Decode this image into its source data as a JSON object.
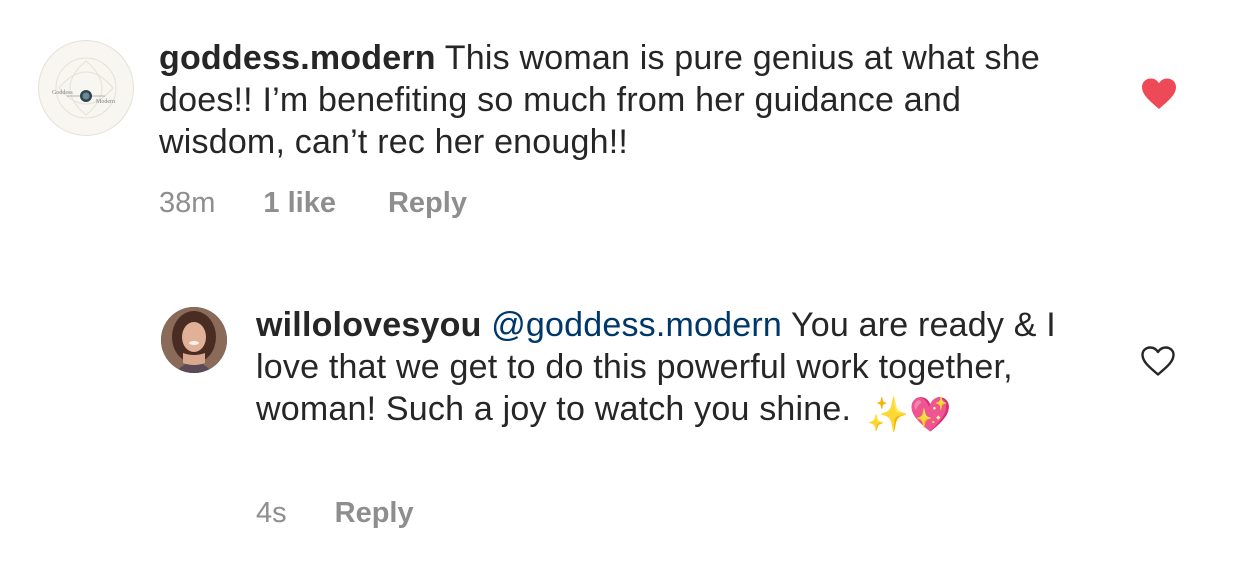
{
  "comments": [
    {
      "avatar_icon": "goddess-modern-logo",
      "avatar_logo_text_left": "Goddess",
      "avatar_logo_text_right": "Modern",
      "username": "goddess.modern",
      "text": "This woman is pure genius at what she does!! I’m benefiting so much from her guidance and wisdom, can’t rec her enough!!",
      "time": "38m",
      "likes": "1 like",
      "reply_label": "Reply",
      "liked": true,
      "heart_color": "#ed4956"
    },
    {
      "avatar_icon": "user-photo-avatar",
      "username": "willolovesyou",
      "mention": "@goddess.modern",
      "text": "You are ready & I love that we get to do this powerful work together, woman! Such a joy to watch you shine.",
      "emoji": "✨💖",
      "time": "4s",
      "reply_label": "Reply",
      "liked": false,
      "heart_color": "#262626"
    }
  ],
  "colors": {
    "text": "#262626",
    "meta": "#8e8e8e",
    "mention": "#00376b",
    "like_red": "#ed4956"
  }
}
